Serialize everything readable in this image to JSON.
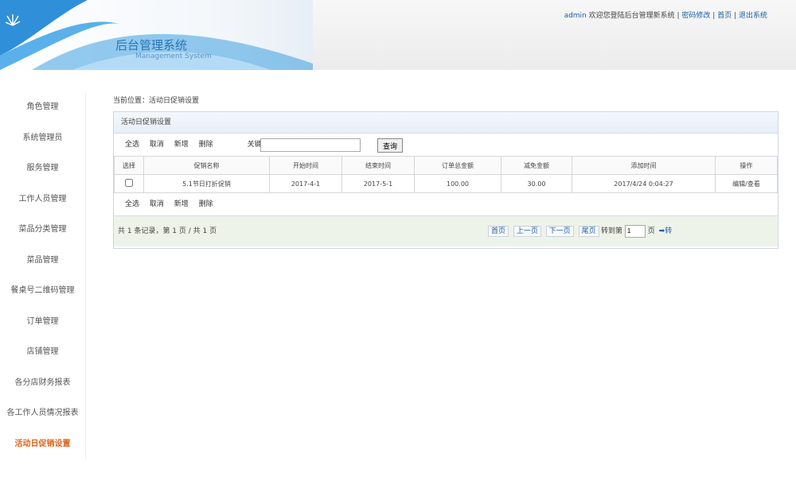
{
  "header": {
    "title": "后台管理系统",
    "subtitle": "Management System",
    "user": "admin",
    "welcome": "欢迎您登陆后台管理新系统 |",
    "links": [
      "密码修改",
      "首页",
      "退出系统"
    ]
  },
  "sidebar": {
    "items": [
      {
        "label": "角色管理"
      },
      {
        "label": "系统管理员"
      },
      {
        "label": "服务管理"
      },
      {
        "label": "工作人员管理"
      },
      {
        "label": "菜品分类管理"
      },
      {
        "label": "菜品管理"
      },
      {
        "label": "餐桌号二维码管理"
      },
      {
        "label": "订单管理"
      },
      {
        "label": "店铺管理"
      },
      {
        "label": "各分店财务报表"
      },
      {
        "label": "各工作人员情况报表"
      },
      {
        "label": "活动日促销设置"
      }
    ],
    "active": "活动日促销设置"
  },
  "breadcrumb": "当前位置：活动日促销设置",
  "panel": {
    "title": "活动日促销设置",
    "toolbar": {
      "select_all": "全选",
      "cancel": "取消",
      "add": "新增",
      "delete": "删除",
      "keyword_label": "关键字:",
      "keyword_value": "",
      "query": "查询"
    },
    "table": {
      "headers": [
        "选择",
        "促销名称",
        "开始时间",
        "结束时间",
        "订单总金额",
        "减免金额",
        "添加时间",
        "操作"
      ],
      "rows": [
        {
          "name": "5.1节日打折促销",
          "start": "2017-4-1",
          "end": "2017-5-1",
          "total": "100.00",
          "discount": "30.00",
          "added": "2017/4/24 0:04:27",
          "action": "编辑/查看"
        }
      ]
    },
    "bottom_toolbar": {
      "select_all": "全选",
      "cancel": "取消",
      "add": "新增",
      "delete": "删除"
    },
    "pager": {
      "summary": "共 1 条记录，第 1 页 / 共 1 页",
      "first": "首页",
      "prev": "上一页",
      "next": "下一页",
      "last": "尾页",
      "goto_label": "转到第",
      "goto_value": "1",
      "page_suffix": "页",
      "go": "➡转"
    }
  },
  "colors": {
    "accent": "#2a76b8",
    "active": "#e26218",
    "link": "#1d5fa6"
  }
}
